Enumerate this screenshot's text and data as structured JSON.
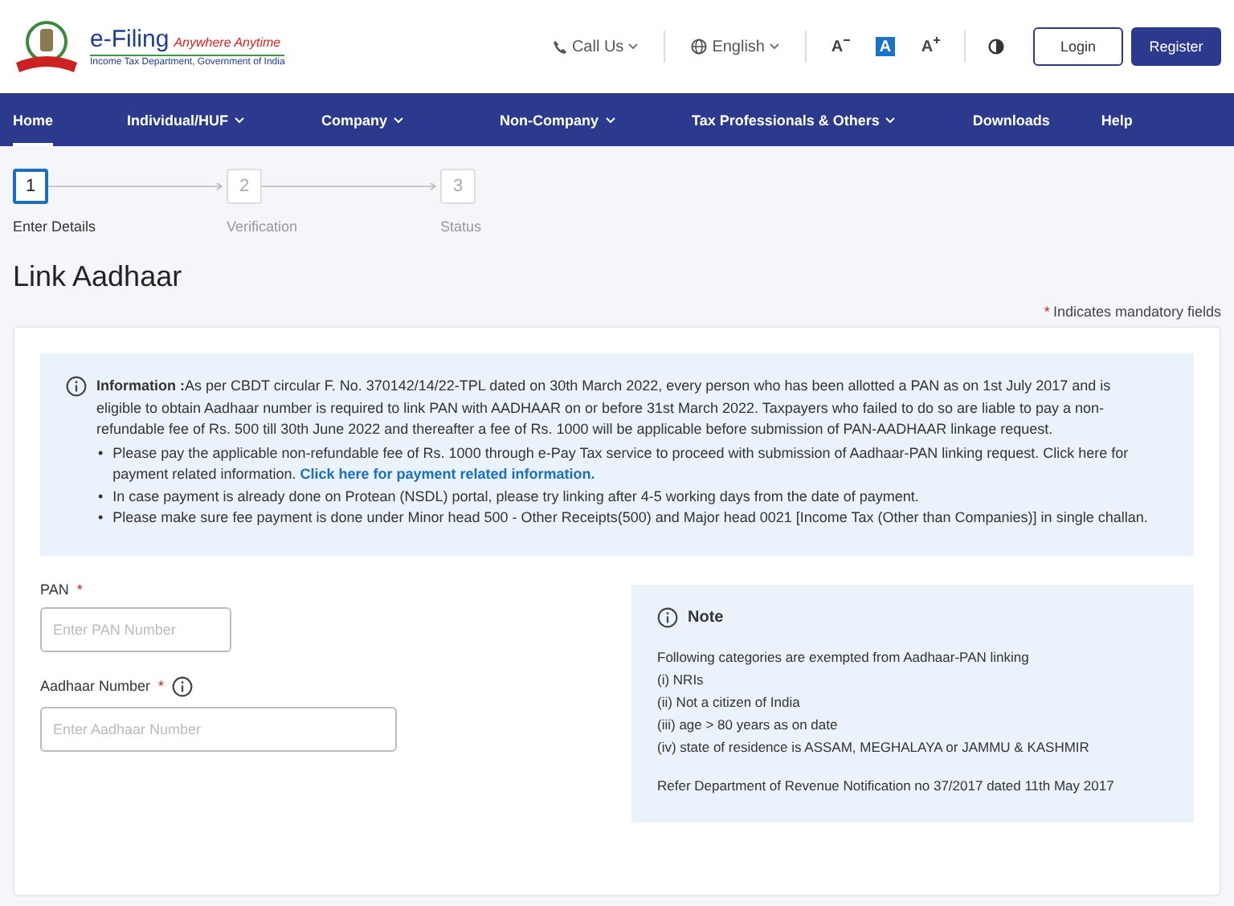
{
  "header": {
    "logo_title": "e-Filing",
    "logo_tagline": "Anywhere Anytime",
    "logo_subtitle": "Income Tax Department, Government of India",
    "call": "Call Us",
    "language": "English",
    "font_sizes": [
      {
        "label": "A",
        "kind": "decrease",
        "selected": false
      },
      {
        "label": "A",
        "kind": "normal",
        "selected": true
      },
      {
        "label": "A",
        "kind": "increase",
        "selected": false
      }
    ],
    "buttons": [
      {
        "label": "Login",
        "kind": "outline"
      },
      {
        "label": "Register",
        "kind": "primary"
      }
    ]
  },
  "nav": [
    {
      "label": "Home",
      "dropdown": false,
      "selected": true
    },
    {
      "label": "Individual/HUF",
      "dropdown": true,
      "selected": false
    },
    {
      "label": "Company",
      "dropdown": true,
      "selected": false
    },
    {
      "label": "Non-Company",
      "dropdown": true,
      "selected": false
    },
    {
      "label": "Tax Professionals & Others",
      "dropdown": true,
      "selected": false
    },
    {
      "label": "Downloads",
      "dropdown": false,
      "selected": false
    },
    {
      "label": "Help",
      "dropdown": false,
      "selected": false
    }
  ],
  "steps": [
    {
      "number": "1",
      "label": "Enter Details",
      "selected": true
    },
    {
      "number": "2",
      "label": "Verification",
      "selected": false
    },
    {
      "number": "3",
      "label": "Status",
      "selected": false
    }
  ],
  "title": "Link Aadhaar",
  "mandatory": {
    "mark": "*",
    "text": "Indicates mandatory fields"
  },
  "information": {
    "text": "**Information :**As per CBDT circular F. No. 370142/14/22-TPL dated on 30th March 2022, every person who has been allotted a PAN as on 1st July 2017 and is eligible to obtain Aadhaar number is required to link PAN with AADHAAR on or before 31st March 2022. Taxpayers who failed to do so are liable to pay a non-refundable fee of Rs. 500 till 30th June 2022 and thereafter a fee of Rs. 1000 will be applicable before submission of PAN-AADHAAR linkage request.",
    "bullet_mark": "•",
    "bullets": [
      {
        "text": "Please pay the applicable non-refundable fee of Rs. 1000 through e-Pay Tax service to proceed with submission of Aadhaar-PAN linking request. Click here for payment related information.",
        "link": "Click here for payment related information."
      },
      {
        "text": "In case payment is already done on Protean (NSDL) portal, please try linking after 4-5 working days from the date of payment."
      },
      {
        "text": "Please make sure fee payment is done under Minor head 500 - Other Receipts(500) and Major head 0021 [Income Tax (Other than Companies)] in single challan."
      }
    ]
  },
  "fields": [
    {
      "label": "PAN",
      "required": true,
      "info": false,
      "placeholder": "Enter PAN Number",
      "kind": "short"
    },
    {
      "label": "Aadhaar Number",
      "required": true,
      "info": true,
      "placeholder": "Enter Aadhaar Number",
      "kind": "long"
    }
  ],
  "required_mark": "*",
  "note": {
    "title": "Note",
    "lines": [
      "Following categories are exempted from Aadhaar-PAN linking",
      "(i) NRIs",
      "(ii) Not a citizen of India",
      "(iii) age > 80 years as on date",
      "(iv) state of residence is ASSAM, MEGHALAYA or JAMMU & KASHMIR"
    ],
    "reference": "Refer Department of Revenue Notification no 37/2017 dated 11th May 2017"
  }
}
